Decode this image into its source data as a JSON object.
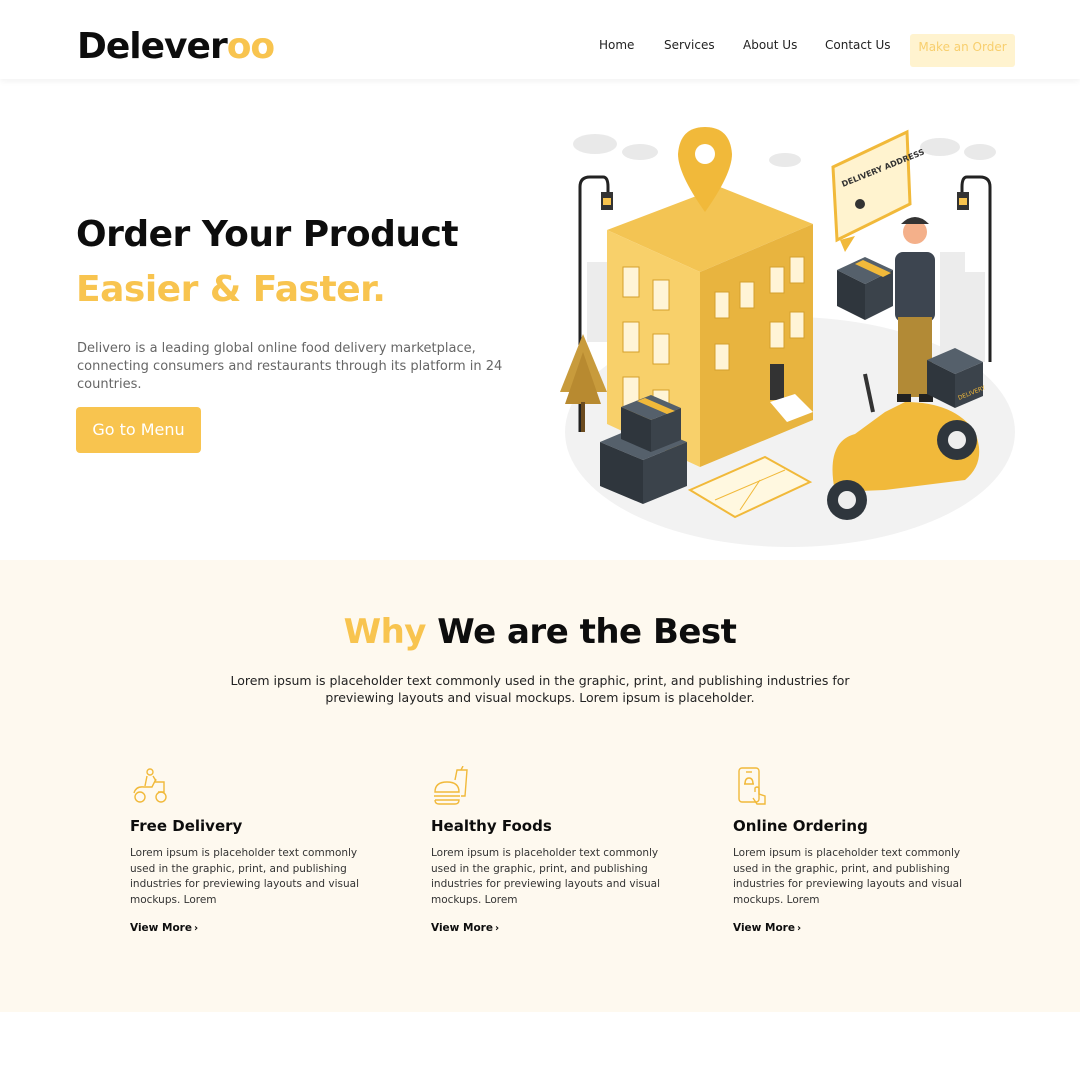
{
  "header": {
    "logo_main": "Delever",
    "logo_accent": "oo",
    "nav": [
      "Home",
      "Services",
      "About Us",
      "Contact Us"
    ],
    "order_button": "Make an Order"
  },
  "hero": {
    "title": "Order Your Product",
    "subtitle": "Easier & Faster.",
    "description": "Delivero is a leading global online food delivery marketplace, connecting consumers and restaurants through its platform in 24 countries.",
    "button": "Go to Menu",
    "sign_text": "DELIVERY ADDRESS",
    "box_text": "DELIVERY"
  },
  "why": {
    "title_accent": "Why",
    "title_main": "We are the Best",
    "description": "Lorem ipsum is placeholder text commonly used in the graphic, print, and publishing industries for previewing layouts and visual mockups. Lorem ipsum is placeholder.",
    "features": [
      {
        "icon": "scooter-delivery-icon",
        "title": "Free Delivery",
        "description": "Lorem ipsum is placeholder text commonly used in the graphic, print, and publishing industries for previewing layouts and visual mockups. Lorem",
        "link": "View More"
      },
      {
        "icon": "burger-drink-icon",
        "title": "Healthy Foods",
        "description": "Lorem ipsum is placeholder text commonly used in the graphic, print, and publishing industries for previewing layouts and visual mockups. Lorem",
        "link": "View More"
      },
      {
        "icon": "phone-order-icon",
        "title": "Online Ordering",
        "description": "Lorem ipsum is placeholder text commonly used in the graphic, print, and publishing industries for previewing layouts and visual mockups. Lorem",
        "link": "View More"
      }
    ]
  },
  "colors": {
    "accent": "#f8c44f",
    "accent_light": "#fff3cf",
    "section_bg": "#fef9ef",
    "text_dark": "#0d0d0d"
  }
}
